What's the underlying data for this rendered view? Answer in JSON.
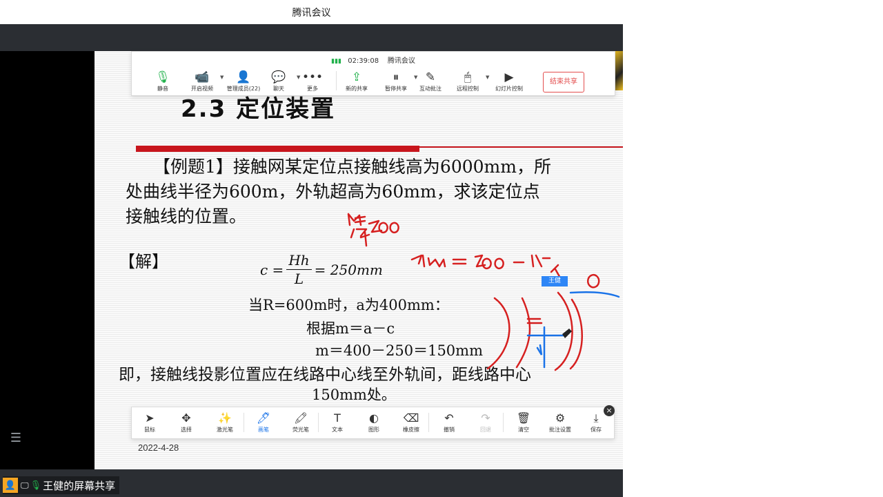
{
  "window": {
    "title": "腾讯会议"
  },
  "share_toolbar": {
    "time": "02:39:08",
    "app_name": "腾讯会议",
    "items": [
      {
        "name": "mute",
        "label": "静音",
        "icon": "🎙"
      },
      {
        "name": "video",
        "label": "开启视频",
        "icon": "📹"
      },
      {
        "name": "members",
        "label": "管理成员(22)",
        "icon": "👤"
      },
      {
        "name": "chat",
        "label": "聊天",
        "icon": "💬"
      },
      {
        "name": "more",
        "label": "更多",
        "icon": "•••"
      },
      {
        "name": "new-share",
        "label": "新的共享",
        "icon": "⇪"
      },
      {
        "name": "pause-share",
        "label": "暂停共享",
        "icon": "⏸"
      },
      {
        "name": "annotate",
        "label": "互动批注",
        "icon": "✎"
      },
      {
        "name": "remote-control",
        "label": "远程控制",
        "icon": "🖱"
      },
      {
        "name": "slideshow-control",
        "label": "幻灯片控制",
        "icon": "▶"
      }
    ],
    "end_share": "结束共享"
  },
  "slide": {
    "title": "2.3   定位装置",
    "p1": "【例题1】接触网某定位点接触线高为6000mm，所",
    "p2": "处曲线半径为600m，外轨超高为60mm，求该定位点",
    "p3": "接触线的位置。",
    "jie": "【解】",
    "formula_lhs": "c =",
    "formula_num": "Hh",
    "formula_den": "L",
    "formula_rhs": "= 250mm",
    "line1": "当R=600m时，a为400mm：",
    "line2": "根据m＝a－c",
    "line3": "m＝400－250＝150mm",
    "line4": "即，接触线投影位置应在线路中心线至外轨间，距线路中心",
    "line5": "150mm处。",
    "date": "2022-4-28"
  },
  "annotation_toolbar": {
    "items": [
      {
        "name": "mouse",
        "label": "鼠标",
        "icon": "➤"
      },
      {
        "name": "select",
        "label": "选择",
        "icon": "✥"
      },
      {
        "name": "laser",
        "label": "激光笔",
        "icon": "✨"
      },
      {
        "name": "pen",
        "label": "画笔",
        "icon": "🖊"
      },
      {
        "name": "highlighter",
        "label": "荧光笔",
        "icon": "🖍"
      },
      {
        "name": "text",
        "label": "文本",
        "icon": "T"
      },
      {
        "name": "shape",
        "label": "图形",
        "icon": "◐"
      },
      {
        "name": "eraser",
        "label": "橡皮擦",
        "icon": "⌫"
      },
      {
        "name": "undo",
        "label": "撤销",
        "icon": "↶"
      },
      {
        "name": "redo",
        "label": "回退",
        "icon": "↷"
      },
      {
        "name": "clear",
        "label": "清空",
        "icon": "🗑"
      },
      {
        "name": "annot-settings",
        "label": "批注设置",
        "icon": "⚙"
      },
      {
        "name": "save",
        "label": "保存",
        "icon": "⤓"
      }
    ],
    "close": "×"
  },
  "annotator_tag": "王健",
  "bottom": {
    "owner_label": "王健的屏幕共享"
  },
  "colors": {
    "accent": "#1a73e8",
    "danger": "#e34d4d",
    "ink_red": "#d62020",
    "ink_blue": "#1a73e8"
  }
}
